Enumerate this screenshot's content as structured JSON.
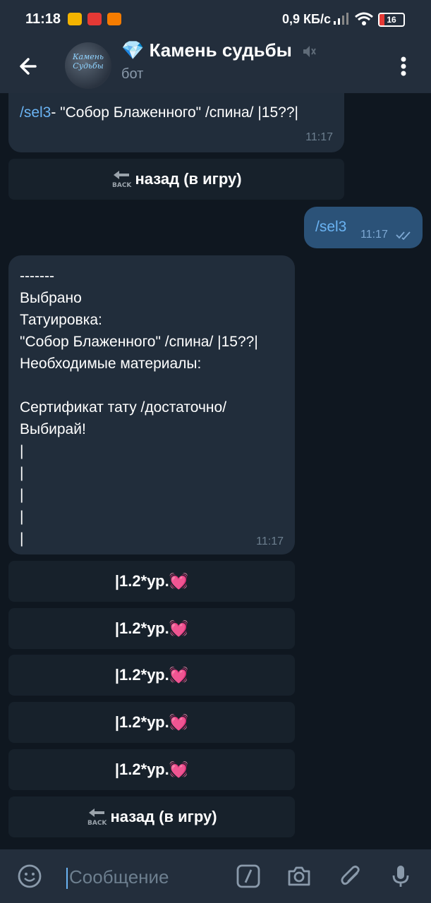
{
  "status_bar": {
    "time": "11:18",
    "net_rate": "0,9 КБ/с",
    "battery": "16"
  },
  "header": {
    "title": "💎 Камень судьбы",
    "subtitle": "бот",
    "avatar_text": "Камень Судьбы"
  },
  "messages": {
    "top_msg": {
      "link": "/sel3",
      "text": "- \"Собор Блаженного\" /спина/ |15??|",
      "time": "11:17"
    },
    "top_back_button": "назад (в игру)",
    "outgoing": {
      "text": "/sel3",
      "time": "11:17"
    },
    "main_msg": {
      "lines": [
        "-------",
        "Выбрано",
        "Татуировка:",
        "\"Собор Блаженного\" /спина/ |15??|",
        "Необходимые материалы:",
        "",
        "Сертификат тату /достаточно/",
        "Выбирай!",
        "|",
        "|",
        "|",
        "|",
        "|"
      ],
      "time": "11:17"
    },
    "keyboard": [
      "|1.2*ур.💓",
      "|1.2*ур.💓",
      "|1.2*ур.💓",
      "|1.2*ур.💓",
      "|1.2*ур.💓"
    ],
    "bottom_back_button": "назад (в игру)",
    "back_icon_label": "BACK"
  },
  "input": {
    "placeholder": "Сообщение"
  },
  "colors": {
    "accent": "#6ab3f3",
    "incoming_bubble": "#212d3b",
    "outgoing_bubble": "#2b5278",
    "chat_bg": "#0f1720",
    "bar_bg": "#232e3c"
  }
}
